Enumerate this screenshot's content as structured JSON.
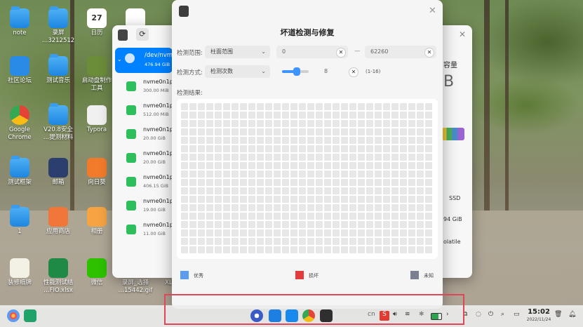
{
  "desktop": {
    "icons": [
      {
        "label": "note",
        "icon": "folder-icon"
      },
      {
        "label": "录屏\n…3212512",
        "icon": "folder-icon"
      },
      {
        "label": "日历",
        "icon": "calendar-icon",
        "day": "27"
      },
      {
        "label": "",
        "icon": "monitor-chart-icon"
      },
      {
        "label": "社区论坛",
        "icon": "deepin-forum-icon"
      },
      {
        "label": "测试音乐",
        "icon": "folder-icon"
      },
      {
        "label": "启动盘制作\n工具",
        "icon": "boot-maker-icon"
      },
      {
        "label": "Google\nChrome",
        "icon": "chrome-icon"
      },
      {
        "label": "V20.8安全\n…提测材料",
        "icon": "folder-icon"
      },
      {
        "label": "Typora",
        "icon": "typora-icon"
      },
      {
        "label": "测试框架",
        "icon": "folder-icon"
      },
      {
        "label": "邮箱",
        "icon": "mail-icon"
      },
      {
        "label": "向日葵",
        "icon": "sunflower-icon"
      },
      {
        "label": "1",
        "icon": "folder-icon"
      },
      {
        "label": "应用商店",
        "icon": "app-store-icon"
      },
      {
        "label": "相册",
        "icon": "album-icon"
      },
      {
        "label": "装修纸牌",
        "icon": "solitaire-icon"
      },
      {
        "label": "性能测试结\n…FIO.xlsx",
        "icon": "excel-icon"
      },
      {
        "label": "微信",
        "icon": "wechat-icon"
      },
      {
        "label": "录屏_选择\n…15442.gif",
        "icon": "gif-file-icon"
      },
      {
        "label": "XLS",
        "icon": "xls-icon"
      }
    ]
  },
  "disk_manager": {
    "devices": [
      {
        "name": "/dev/nvme…",
        "size": "476.94 GiB"
      }
    ],
    "partitions": [
      {
        "name": "nvme0n1p…",
        "size": "300.00 MiB"
      },
      {
        "name": "nvme0n1p…",
        "size": "512.00 MiB"
      },
      {
        "name": "nvme0n1p…",
        "size": "20.00 GiB"
      },
      {
        "name": "nvme0n1p…",
        "size": "20.00 GiB"
      },
      {
        "name": "nvme0n1p…",
        "size": "406.15 GiB"
      },
      {
        "name": "nvme0n1p…",
        "size": "19.00 GiB"
      },
      {
        "name": "nvme0n1p…",
        "size": "11.00 GiB"
      }
    ],
    "right_texts": {
      "capacity": "容量",
      "big": "B",
      "type": "SSD",
      "size": "94 GiB",
      "volatile": "olatile"
    }
  },
  "dialog": {
    "title": "坏道检测与修复",
    "range_label": "检测范围:",
    "range_combo": "柱面范围",
    "range_from": "0",
    "range_dash": "—",
    "range_to": "62260",
    "method_label": "检测方式:",
    "method_combo": "检测次数",
    "method_value": "8",
    "method_hint": "(1-16)",
    "slider_fraction": 0.55,
    "result_label": "检测结果:",
    "grid_rows": 18,
    "grid_cols": 30,
    "legend": [
      {
        "label": "优秀",
        "color": "#5b9bf0"
      },
      {
        "label": "损坏",
        "color": "#e33b3b"
      },
      {
        "label": "未知",
        "color": "#7a7f92"
      }
    ]
  },
  "taskbar": {
    "clock": "15:02",
    "date": "2022/11/24",
    "lang": "cn",
    "apps": [
      "launcher-icon",
      "multitask-icon",
      "settings-icon",
      "file-manager-icon",
      "app-store-icon",
      "chrome-icon",
      "disk-utility-icon"
    ]
  }
}
